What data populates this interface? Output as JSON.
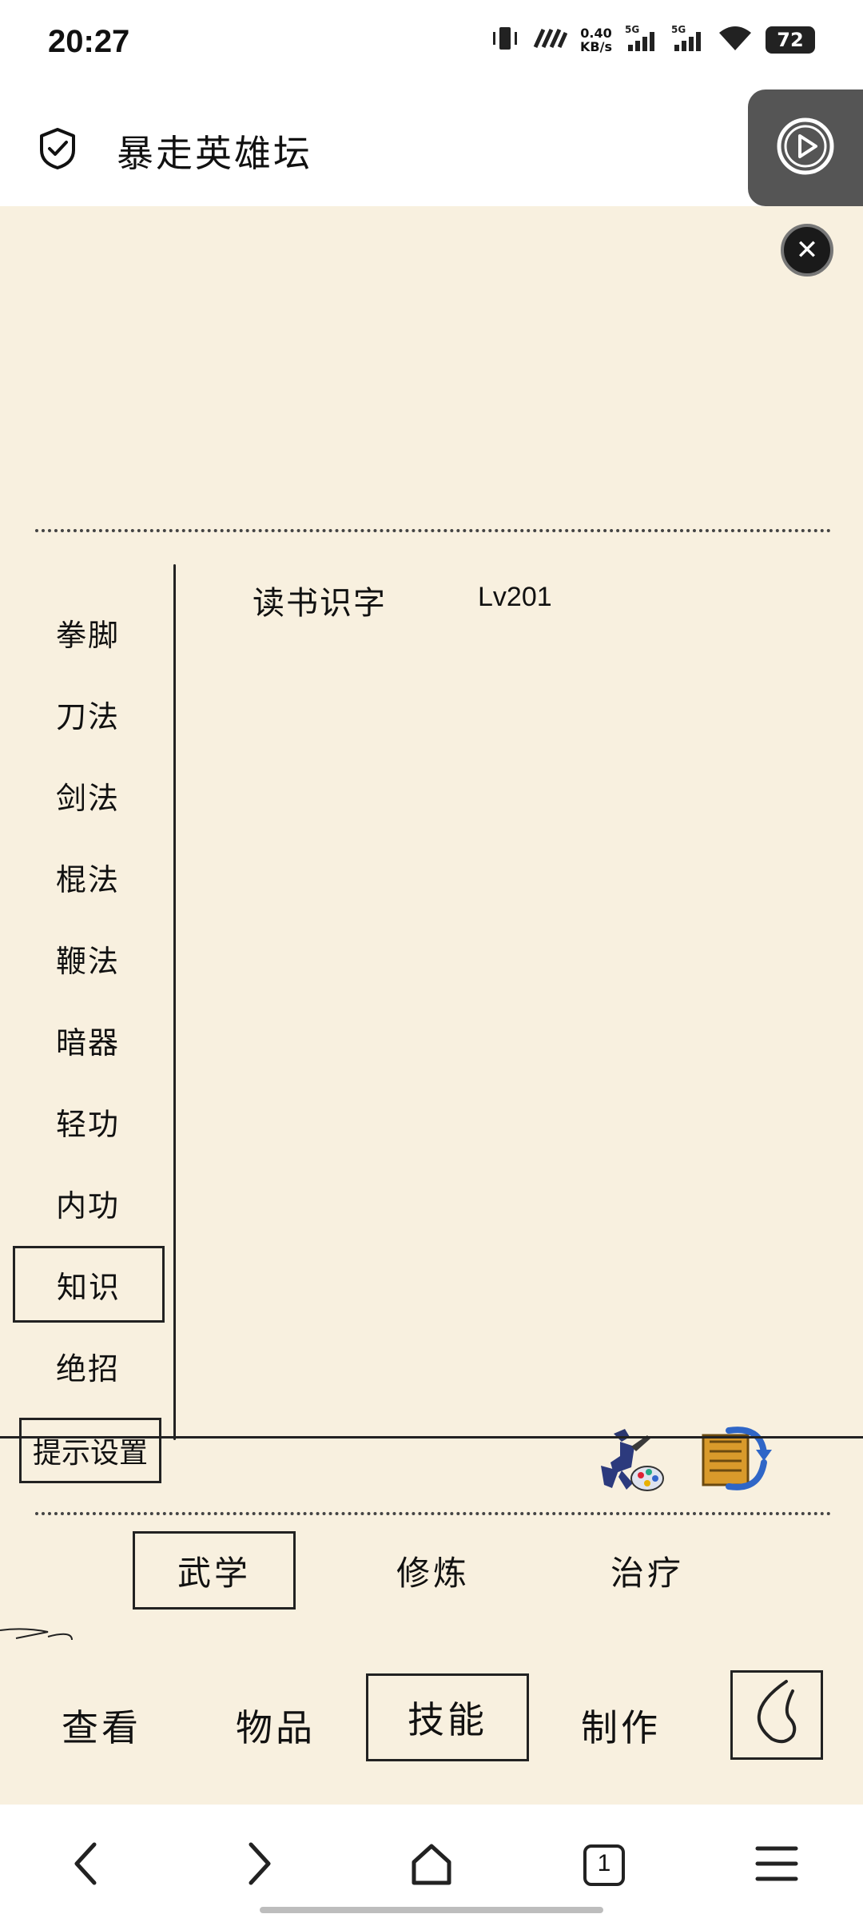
{
  "status_bar": {
    "time": "20:27",
    "net_speed_value": "0.40",
    "net_speed_unit": "KB/s",
    "sim1_label": "5G",
    "sim2_label": "5G",
    "battery": "72"
  },
  "header": {
    "title": "暴走英雄坛"
  },
  "game": {
    "categories": [
      {
        "label": "拳脚"
      },
      {
        "label": "刀法"
      },
      {
        "label": "剑法"
      },
      {
        "label": "棍法"
      },
      {
        "label": "鞭法"
      },
      {
        "label": "暗器"
      },
      {
        "label": "轻功"
      },
      {
        "label": "内功"
      },
      {
        "label": "知识",
        "active": true
      },
      {
        "label": "绝招"
      }
    ],
    "hint_settings_label": "提示设置",
    "skills": [
      {
        "name": "读书识字",
        "level": "Lv201"
      }
    ],
    "subtabs": [
      {
        "label": "武学",
        "active": true
      },
      {
        "label": "修炼"
      },
      {
        "label": "治疗"
      }
    ]
  },
  "bottom_nav": {
    "tabs": [
      {
        "label": "查看"
      },
      {
        "label": "物品"
      },
      {
        "label": "技能",
        "active": true
      },
      {
        "label": "制作"
      }
    ]
  },
  "browser_nav": {
    "tab_count": "1"
  },
  "icons": {
    "shield": "shield-check-icon",
    "float": "play-circle-icon",
    "close": "close-icon",
    "utility1": "warrior-palette-icon",
    "utility2": "book-swap-icon",
    "menu_back": "curved-back-icon"
  },
  "colors": {
    "game_bg": "#f8f0df",
    "ink": "#222222",
    "float_bg": "#555555"
  }
}
